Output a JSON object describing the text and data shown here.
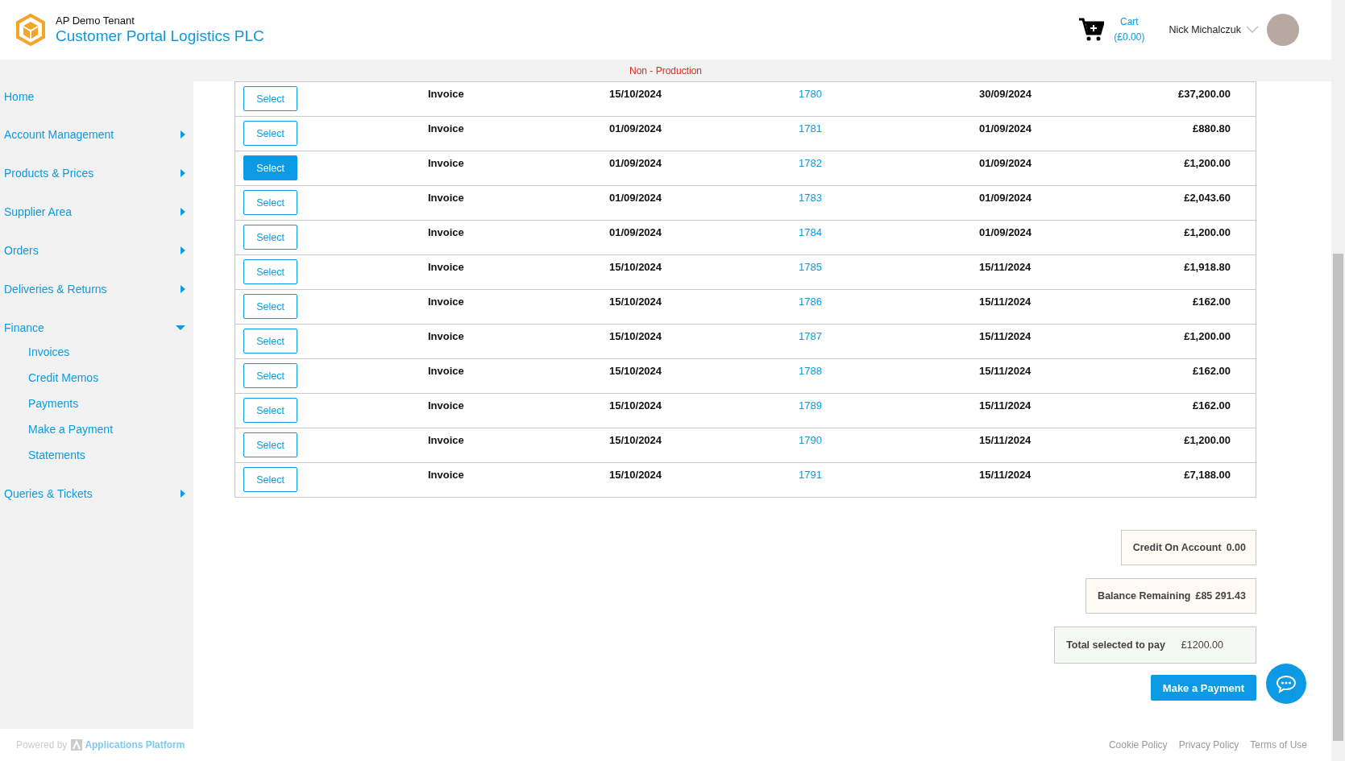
{
  "header": {
    "tenant": "AP Demo Tenant",
    "company": "Customer Portal Logistics PLC",
    "cart": {
      "label": "Cart",
      "amount": "(£0.00)"
    },
    "user": {
      "name": "Nick Michalczuk"
    }
  },
  "environment_banner": "Non - Production",
  "sidebar": {
    "items": [
      {
        "label": "Home"
      },
      {
        "label": "Account Management",
        "expanded": false
      },
      {
        "label": "Products & Prices",
        "expanded": false
      },
      {
        "label": "Supplier Area",
        "expanded": false
      },
      {
        "label": "Orders",
        "expanded": false
      },
      {
        "label": "Deliveries & Returns",
        "expanded": false
      },
      {
        "label": "Finance",
        "expanded": true,
        "children": [
          {
            "label": "Invoices"
          },
          {
            "label": "Credit Memos"
          },
          {
            "label": "Payments"
          },
          {
            "label": "Make a Payment"
          },
          {
            "label": "Statements"
          }
        ]
      },
      {
        "label": "Queries & Tickets",
        "expanded": false
      }
    ]
  },
  "table": {
    "rows": [
      {
        "button": "Select",
        "selected": false,
        "type": "Invoice",
        "date": "15/10/2024",
        "number": "1780",
        "due_date": "30/09/2024",
        "amount": "£37,200.00"
      },
      {
        "button": "Select",
        "selected": false,
        "type": "Invoice",
        "date": "01/09/2024",
        "number": "1781",
        "due_date": "01/09/2024",
        "amount": "£880.80"
      },
      {
        "button": "Select",
        "selected": true,
        "type": "Invoice",
        "date": "01/09/2024",
        "number": "1782",
        "due_date": "01/09/2024",
        "amount": "£1,200.00"
      },
      {
        "button": "Select",
        "selected": false,
        "type": "Invoice",
        "date": "01/09/2024",
        "number": "1783",
        "due_date": "01/09/2024",
        "amount": "£2,043.60"
      },
      {
        "button": "Select",
        "selected": false,
        "type": "Invoice",
        "date": "01/09/2024",
        "number": "1784",
        "due_date": "01/09/2024",
        "amount": "£1,200.00"
      },
      {
        "button": "Select",
        "selected": false,
        "type": "Invoice",
        "date": "15/10/2024",
        "number": "1785",
        "due_date": "15/11/2024",
        "amount": "£1,918.80"
      },
      {
        "button": "Select",
        "selected": false,
        "type": "Invoice",
        "date": "15/10/2024",
        "number": "1786",
        "due_date": "15/11/2024",
        "amount": "£162.00"
      },
      {
        "button": "Select",
        "selected": false,
        "type": "Invoice",
        "date": "15/10/2024",
        "number": "1787",
        "due_date": "15/11/2024",
        "amount": "£1,200.00"
      },
      {
        "button": "Select",
        "selected": false,
        "type": "Invoice",
        "date": "15/10/2024",
        "number": "1788",
        "due_date": "15/11/2024",
        "amount": "£162.00"
      },
      {
        "button": "Select",
        "selected": false,
        "type": "Invoice",
        "date": "15/10/2024",
        "number": "1789",
        "due_date": "15/11/2024",
        "amount": "£162.00"
      },
      {
        "button": "Select",
        "selected": false,
        "type": "Invoice",
        "date": "15/10/2024",
        "number": "1790",
        "due_date": "15/11/2024",
        "amount": "£1,200.00"
      },
      {
        "button": "Select",
        "selected": false,
        "type": "Invoice",
        "date": "15/10/2024",
        "number": "1791",
        "due_date": "15/11/2024",
        "amount": "£7,188.00"
      }
    ]
  },
  "summary": [
    {
      "label": "Credit On Account",
      "value": "0.00",
      "kind": "credit"
    },
    {
      "label": "Balance Remaining",
      "value": "£85 291.43",
      "kind": "balance"
    },
    {
      "label": "Total selected to pay",
      "value": "£1200.00",
      "kind": "total"
    }
  ],
  "pay_button": "Make a Payment",
  "footer": {
    "powered_by": "Powered by",
    "platform": "Applications Platform",
    "links": [
      "Cookie Policy",
      "Privacy Policy",
      "Terms of Use"
    ]
  }
}
